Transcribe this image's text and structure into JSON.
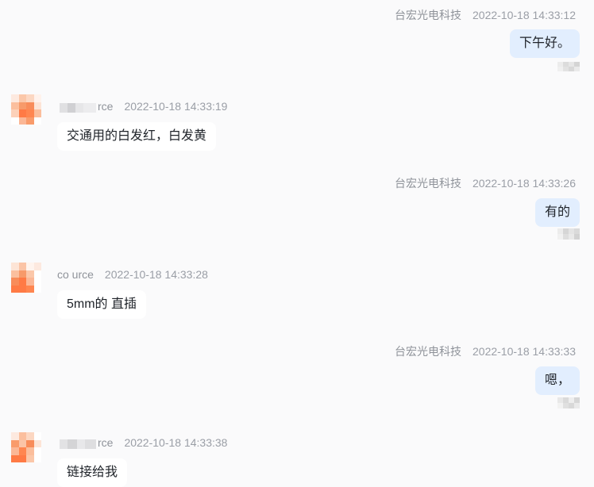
{
  "messages": [
    {
      "dir": "out",
      "sender": "台宏光电科技",
      "time": "2022-10-18 14:33:12",
      "text": "下午好。"
    },
    {
      "dir": "in",
      "sender": "rce",
      "time": "2022-10-18 14:33:19",
      "text": "交通用的白发红，白发黄"
    },
    {
      "dir": "out",
      "sender": "台宏光电科技",
      "time": "2022-10-18 14:33:26",
      "text": "有的"
    },
    {
      "dir": "in",
      "sender": "co urce",
      "time": "2022-10-18 14:33:28",
      "text": "5mm的 直插"
    },
    {
      "dir": "out",
      "sender": "台宏光电科技",
      "time": "2022-10-18 14:33:33",
      "text": "嗯，"
    },
    {
      "dir": "in",
      "sender": "rce",
      "time": "2022-10-18 14:33:38",
      "text": "链接给我"
    }
  ],
  "colors": {
    "outgoing_bubble": "#e2eefe",
    "incoming_bubble": "#ffffff",
    "avatar_accent": "#ff7a45"
  }
}
